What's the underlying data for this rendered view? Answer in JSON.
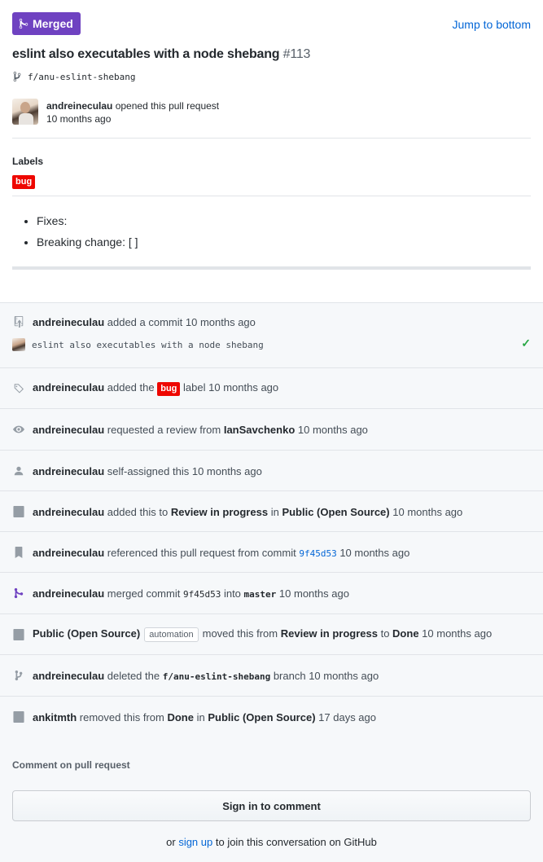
{
  "header": {
    "status_label": "Merged",
    "jump_label": "Jump to bottom",
    "title": "eslint also executables with a node shebang",
    "number": "#113",
    "branch": "f/anu-eslint-shebang",
    "author": "andreineculau",
    "opened_text": "opened this pull request",
    "opened_time": "10 months ago"
  },
  "labels": {
    "heading": "Labels",
    "items": [
      "bug"
    ]
  },
  "description": {
    "items": [
      "Fixes:",
      "Breaking change: [ ]"
    ]
  },
  "timeline": [
    {
      "actor": "andreineculau",
      "text": "added a commit",
      "time": "10 months ago",
      "commit_message": "eslint also executables with a node shebang",
      "check": "✓"
    },
    {
      "actor": "andreineculau",
      "pre": "added the",
      "label": "bug",
      "post": "label",
      "time": "10 months ago"
    },
    {
      "actor": "andreineculau",
      "pre": "requested a review from",
      "target": "IanSavchenko",
      "time": "10 months ago"
    },
    {
      "actor": "andreineculau",
      "pre": "self-assigned this",
      "time": "10 months ago"
    },
    {
      "actor": "andreineculau",
      "pre": "added this to",
      "column": "Review in progress",
      "mid": "in",
      "project": "Public (Open Source)",
      "time": "10 months ago"
    },
    {
      "actor": "andreineculau",
      "pre": "referenced this pull request from commit",
      "sha": "9f45d53",
      "time": "10 months ago"
    },
    {
      "actor": "andreineculau",
      "pre": "merged commit",
      "sha": "9f45d53",
      "mid": "into",
      "branch": "master",
      "time": "10 months ago"
    },
    {
      "actor": "Public (Open Source)",
      "badge": "automation",
      "pre": "moved this from",
      "from": "Review in progress",
      "mid": "to",
      "to": "Done",
      "time": "10 months ago"
    },
    {
      "actor": "andreineculau",
      "pre": "deleted the",
      "branch": "f/anu-eslint-shebang",
      "post": "branch",
      "time": "10 months ago"
    },
    {
      "actor": "ankitmth",
      "pre": "removed this from",
      "column": "Done",
      "mid": "in",
      "project": "Public (Open Source)",
      "time": "17 days ago"
    }
  ],
  "footer": {
    "title": "Comment on pull request",
    "sign_in_label": "Sign in to comment",
    "note_pre": "or",
    "note_link": "sign up",
    "note_post": "to join this conversation on GitHub"
  },
  "colors": {
    "merged": "#6f42c1",
    "link": "#0366d6",
    "bug_label": "#ee0701",
    "success": "#28a745"
  }
}
